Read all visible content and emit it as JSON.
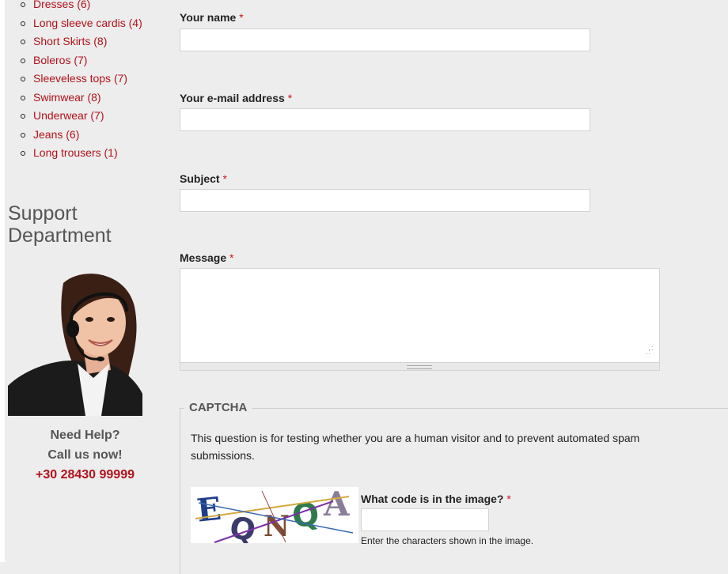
{
  "categories": [
    {
      "label": "Dresses (6)"
    },
    {
      "label": "Long sleeve cardis (4)"
    },
    {
      "label": "Short Skirts (8)"
    },
    {
      "label": "Boleros (7)"
    },
    {
      "label": "Sleeveless tops (7)"
    },
    {
      "label": "Swimwear (8)"
    },
    {
      "label": "Underwear (7)"
    },
    {
      "label": "Jeans (6)"
    },
    {
      "label": "Long trousers (1)"
    }
  ],
  "support": {
    "title_line1": "Support",
    "title_line2": "Department",
    "help_line1": "Need Help?",
    "help_line2": "Call us now!",
    "phone": "+30 28430 99999"
  },
  "form": {
    "required_marker": "*",
    "name_label": "Your name",
    "name_value": "",
    "email_label": "Your e-mail address",
    "email_value": "",
    "subject_label": "Subject",
    "subject_value": "",
    "message_label": "Message",
    "message_value": ""
  },
  "captcha": {
    "legend": "CAPTCHA",
    "description": "This question is for testing whether you are a human visitor and to prevent automated spam submissions.",
    "image_code": "EQNQA",
    "question": "What code is in the image?",
    "answer_value": "",
    "help_text": "Enter the characters shown in the image."
  },
  "colors": {
    "link_red": "#b2111b",
    "required_red": "#d0111b",
    "background": "#ededed"
  }
}
